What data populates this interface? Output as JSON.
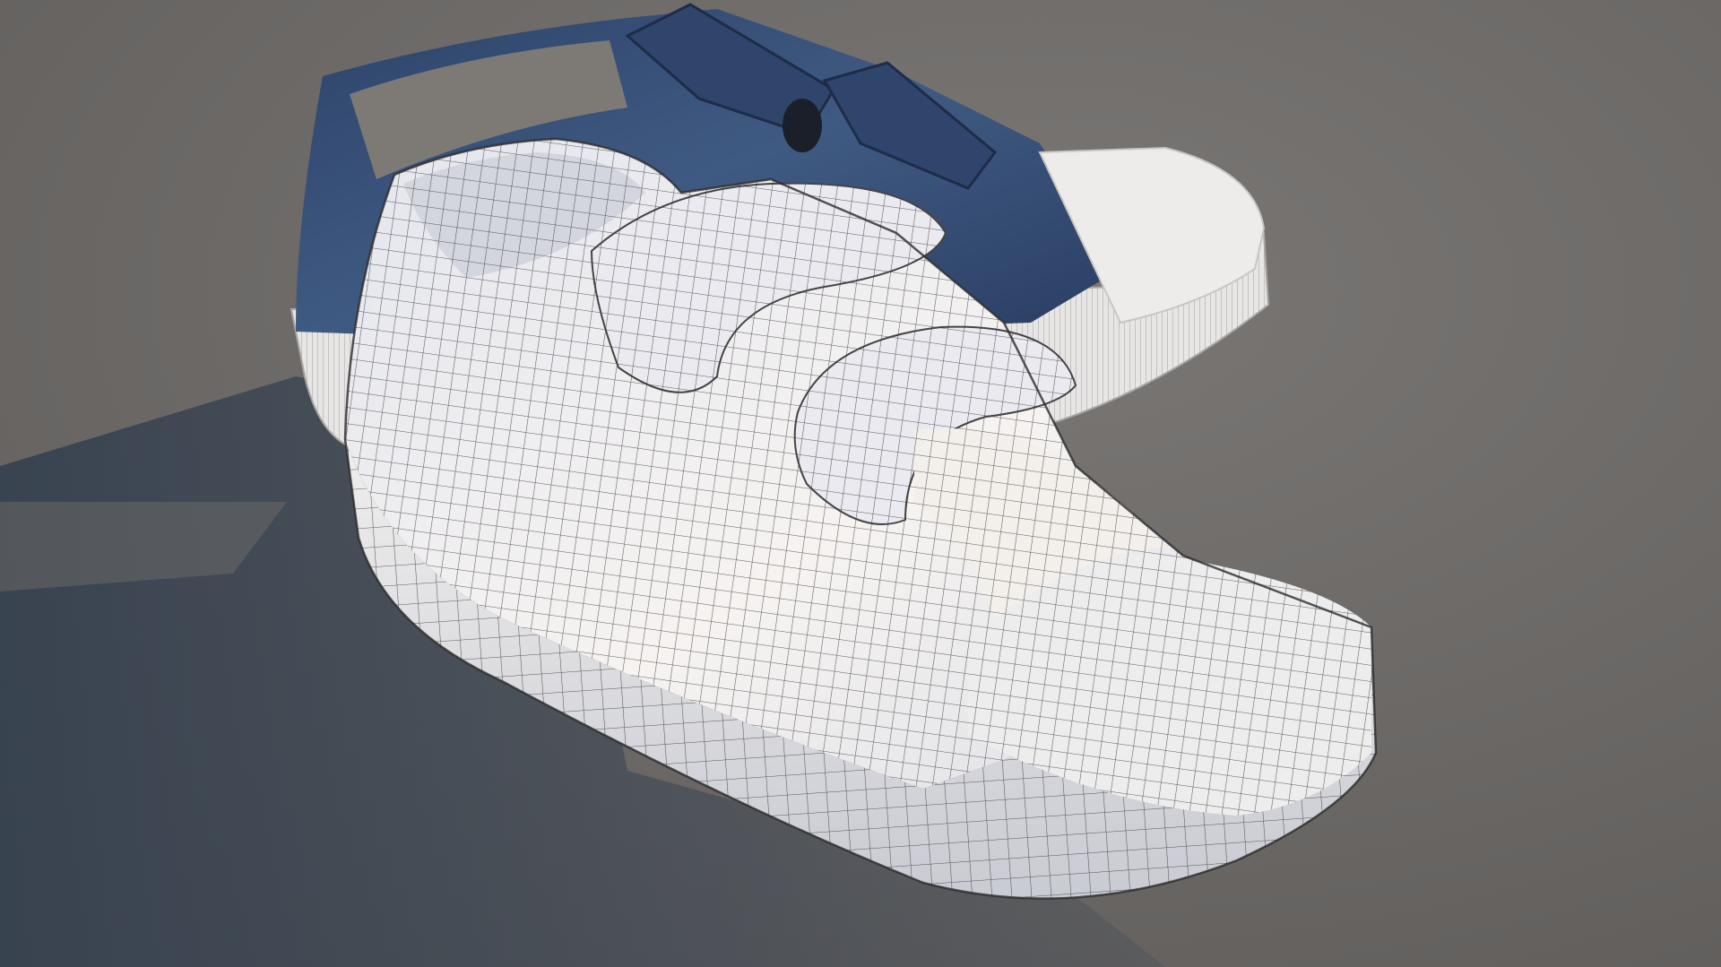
{
  "scene": {
    "background_color": "#6e6b68",
    "shadow_color": "#2f3a4a",
    "denim_color": "#3b5277",
    "denim_dark": "#243556",
    "rubber_color": "#e6e4e2",
    "mesh_color": "#f1efee",
    "wire_color": "#2a2a2a"
  },
  "objects": [
    "wireframe-shoe",
    "textured-denim-shoe"
  ]
}
